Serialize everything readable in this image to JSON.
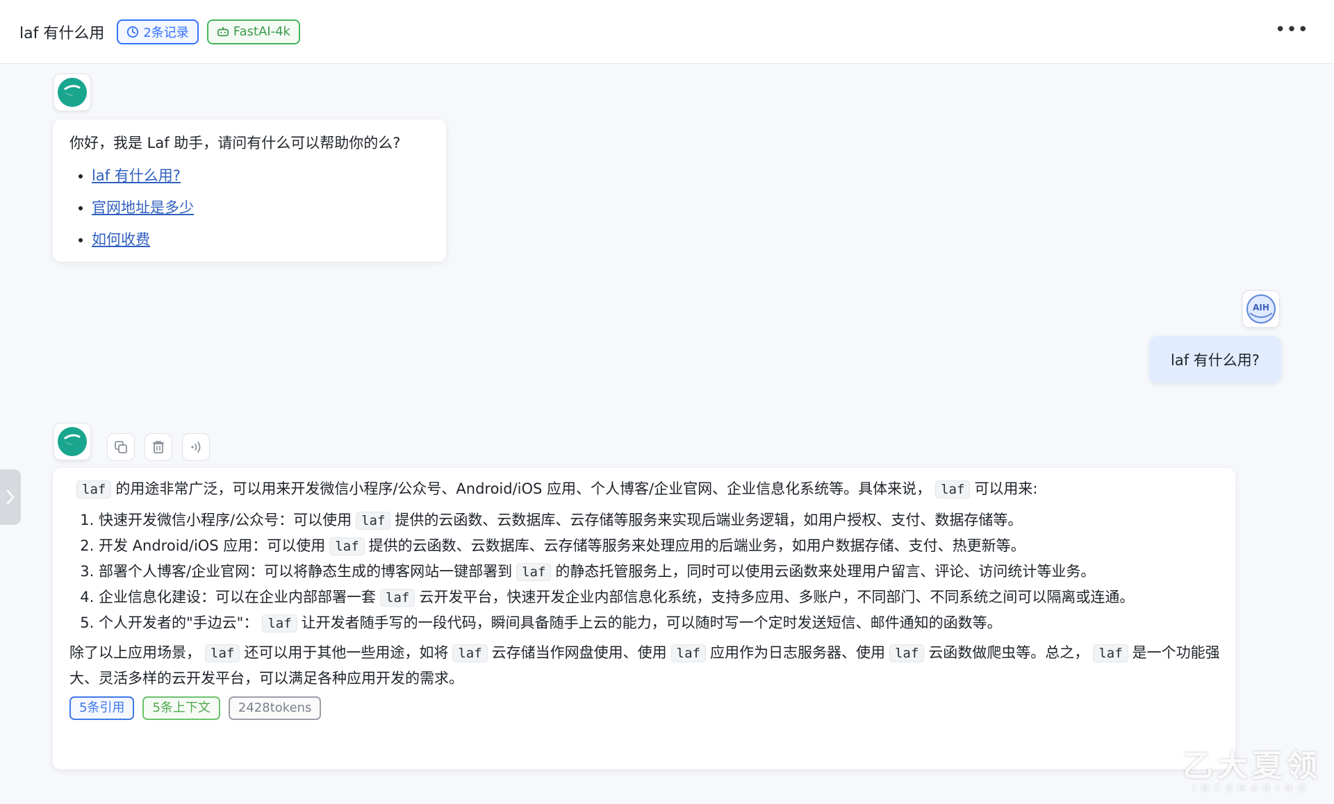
{
  "header": {
    "title": "laf 有什么用",
    "history_tag": "2条记录",
    "model_tag": "FastAI-4k",
    "more_label": "•••"
  },
  "welcome": {
    "text": "你好，我是 Laf 助手，请问有什么可以帮助你的么?",
    "links": [
      "laf 有什么用? ",
      "官网地址是多少",
      "如何收费"
    ]
  },
  "user_message": {
    "text": "laf 有什么用?",
    "avatar_label": "AIH"
  },
  "answer": {
    "intro": {
      "code1": "laf",
      "t1": "的用途非常广泛，可以用来开发微信小程序/公众号、Android/iOS 应用、个人博客/企业官网、企业信息化系统等。具体来说，",
      "code2": "laf",
      "t2": "可以用来:"
    },
    "items": [
      {
        "pre": "快速开发微信小程序/公众号：可以使用",
        "code": "laf",
        "post": "提供的云函数、云数据库、云存储等服务来实现后端业务逻辑，如用户授权、支付、数据存储等。"
      },
      {
        "pre": "开发 Android/iOS 应用：可以使用",
        "code": "laf",
        "post": "提供的云函数、云数据库、云存储等服务来处理应用的后端业务，如用户数据存储、支付、热更新等。"
      },
      {
        "pre": "部署个人博客/企业官网：可以将静态生成的博客网站一键部署到",
        "code": "laf",
        "post": "的静态托管服务上，同时可以使用云函数来处理用户留言、评论、访问统计等业务。"
      },
      {
        "pre": "企业信息化建设：可以在企业内部部署一套",
        "code": "laf",
        "post": "云开发平台，快速开发企业内部信息化系统，支持多应用、多账户，不同部门、不同系统之间可以隔离或连通。"
      },
      {
        "pre": "个人开发者的\"手边云\"：",
        "code": "laf",
        "post": "让开发者随手写的一段代码，瞬间具备随手上云的能力，可以随时写一个定时发送短信、邮件通知的函数等。"
      }
    ],
    "summary": {
      "t1": "除了以上应用场景，",
      "c1": "laf",
      "t2": "还可以用于其他一些用途，如将",
      "c2": "laf",
      "t3": "云存储当作网盘使用、使用",
      "c3": "laf",
      "t4": "应用作为日志服务器、使用",
      "c4": "laf",
      "t5": "云函数做爬虫等。总之，",
      "c5": "laf",
      "t6": "是一个功能强大、灵活多样的云开发平台，可以满足各种应用开发的需求。"
    },
    "tags": {
      "quotes": "5条引用",
      "context": "5条上下文",
      "tokens": "2428tokens"
    }
  },
  "watermark": {
    "main": "乙大夏领",
    "sub": "INTSHARING"
  },
  "colors": {
    "accent": "#3370ff",
    "green": "#47b65a",
    "bot_logo": "#1aa58f",
    "user_bubble": "#e1ecff"
  },
  "icons": {
    "history": "clock-icon",
    "model": "robot-icon",
    "copy": "copy-icon",
    "delete": "trash-icon",
    "speak": "sound-icon",
    "toggle": "chevron-right-icon"
  }
}
